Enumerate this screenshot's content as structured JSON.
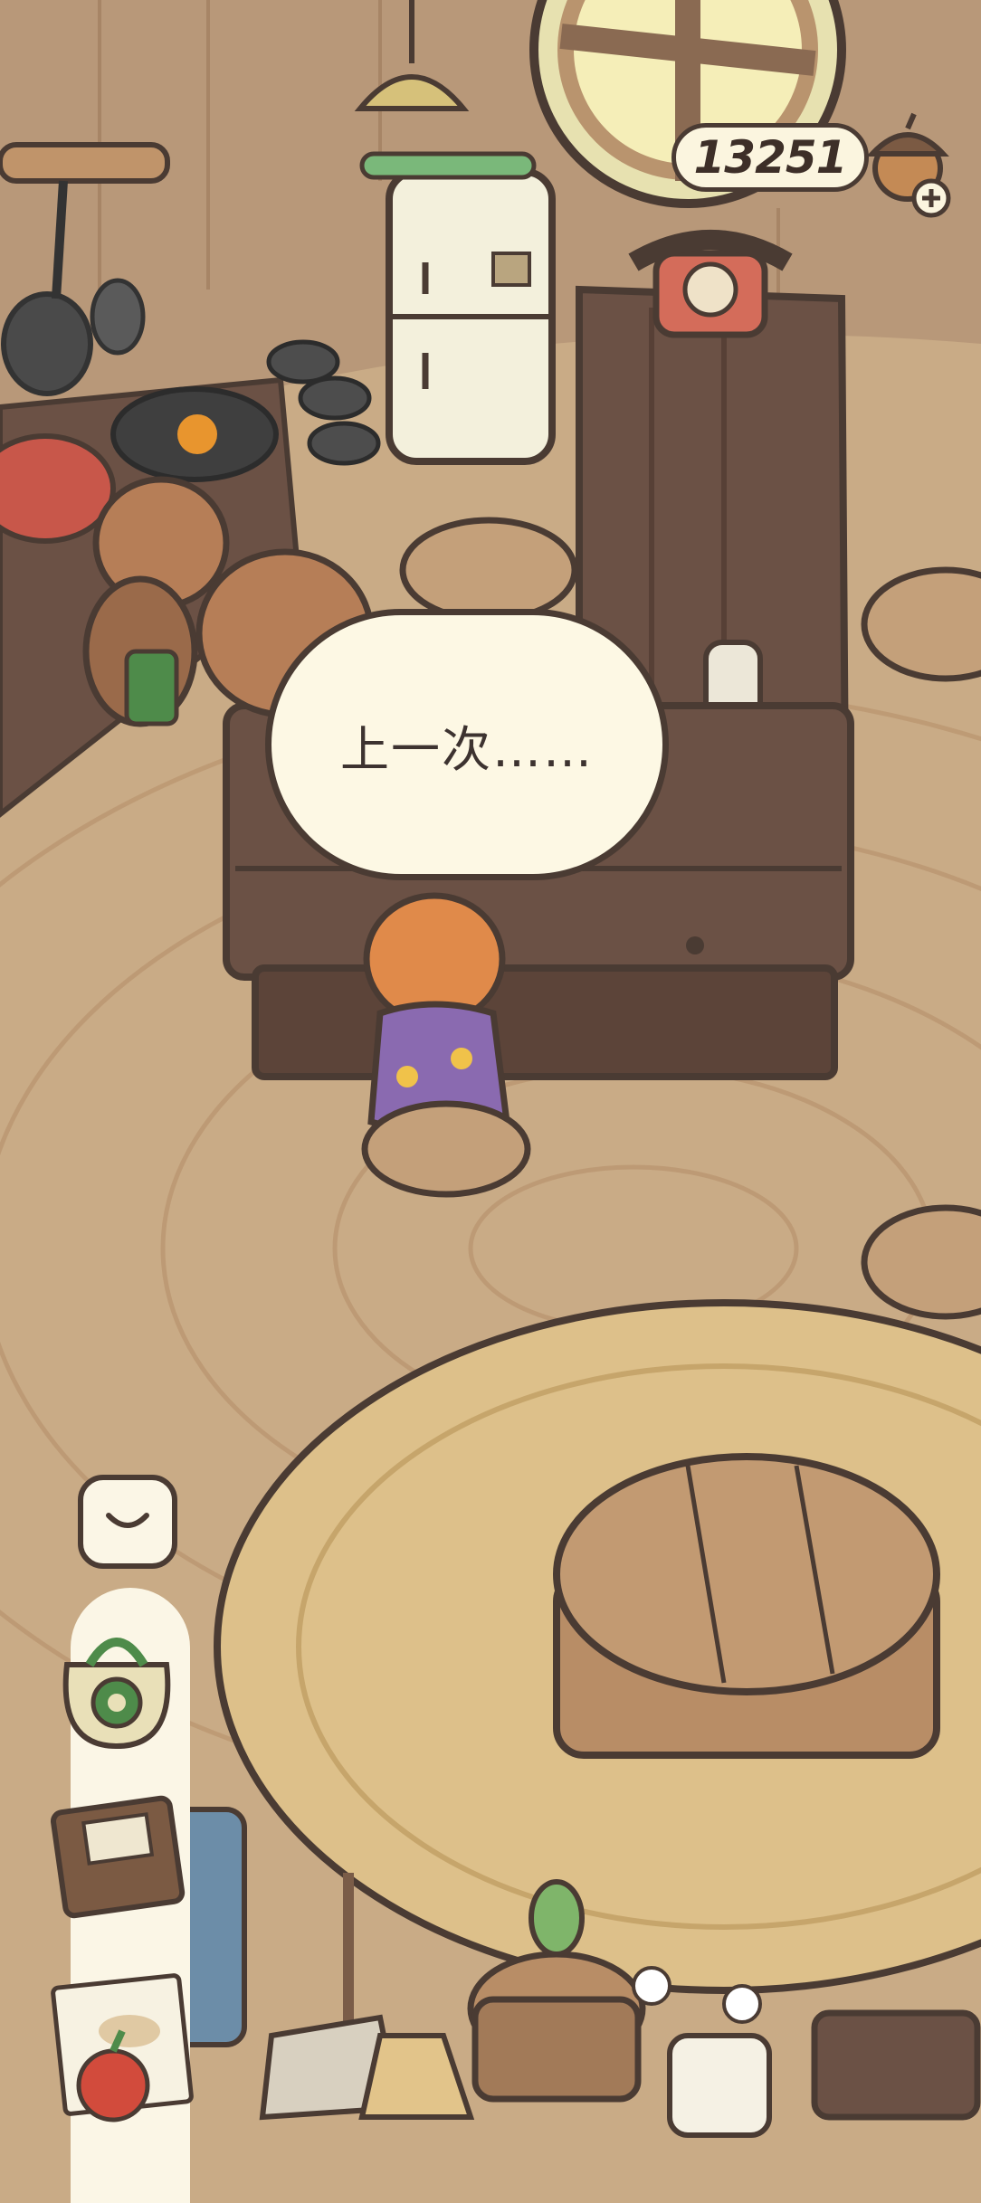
{
  "hud": {
    "currency_value": "13251",
    "currency_icon": "acorn-icon",
    "add_icon": "plus-icon"
  },
  "dialogue": {
    "text": "上一次……"
  },
  "toolbar": {
    "collapse_icon": "chevron-down-icon",
    "items": [
      {
        "name": "bag-icon"
      },
      {
        "name": "recipe-book-icon"
      },
      {
        "name": "notes-icon"
      }
    ]
  },
  "colors": {
    "outline": "#4a3b33",
    "floor": "#c9ab86",
    "wall": "#b89879",
    "counter": "#6b5145",
    "rug": "#ddc08a",
    "bubble": "#fdf8e4"
  }
}
